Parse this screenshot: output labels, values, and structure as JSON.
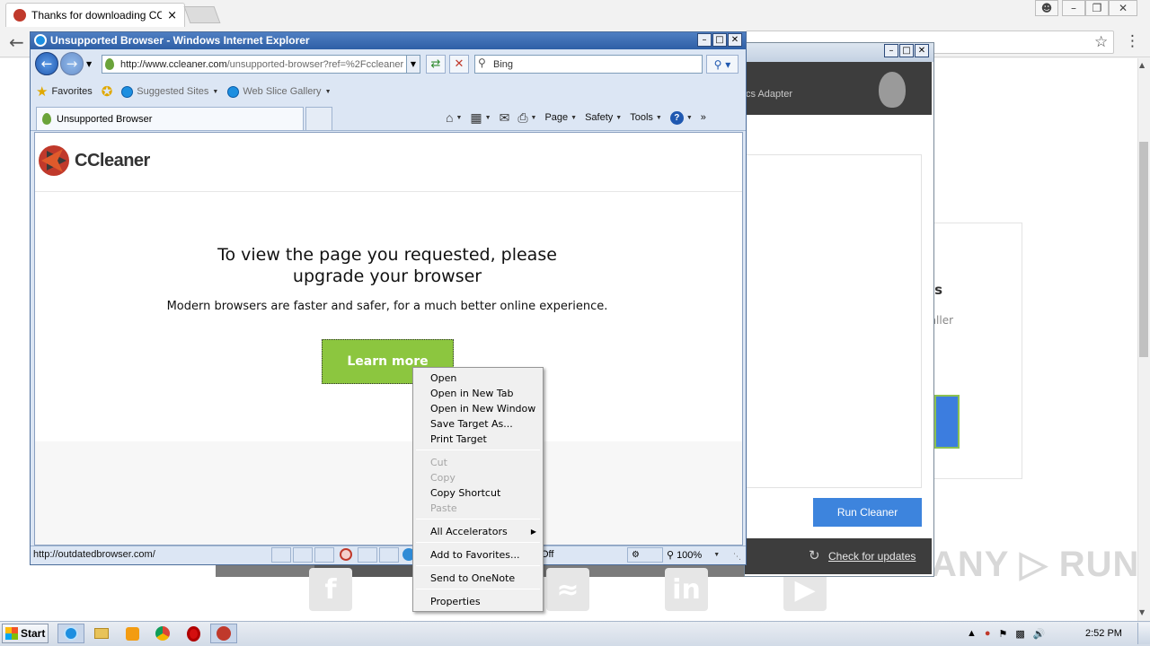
{
  "chrome": {
    "tab_title": "Thanks for downloading CCleaner",
    "tab_close": "×"
  },
  "background_page": {
    "card_text1": "as",
    "card_text2": "taller",
    "watermark": "ANY ▷ RUN"
  },
  "ccleaner_app": {
    "header_text": "cs Adapter",
    "run_button": "Run Cleaner",
    "update_link": "Check for updates"
  },
  "ie": {
    "window_title": "Unsupported Browser - Windows Internet Explorer",
    "address_host": "http://www.ccleaner.com",
    "address_path": "/unsupported-browser?ref=%2Fccleaner",
    "search_placeholder": "Bing",
    "favorites": {
      "favorites_label": "Favorites",
      "suggested_sites": "Suggested Sites",
      "web_slice_gallery": "Web Slice Gallery"
    },
    "tab_title": "Unsupported Browser",
    "commands": {
      "page": "Page",
      "safety": "Safety",
      "tools": "Tools"
    },
    "content": {
      "logo_text": "CCleaner",
      "heading_line1": "To view the page you requested, please",
      "heading_line2": "upgrade your browser",
      "subtext": "Modern browsers are faster and safer, for a much better online experience.",
      "learn_more": "Learn more"
    },
    "status": {
      "url": "http://outdatedbrowser.com/",
      "protected_mode": "Off",
      "zoom": "100%"
    }
  },
  "context_menu": {
    "items": [
      {
        "label": "Open",
        "enabled": true
      },
      {
        "label": "Open in New Tab",
        "enabled": true
      },
      {
        "label": "Open in New Window",
        "enabled": true
      },
      {
        "label": "Save Target As...",
        "enabled": true
      },
      {
        "label": "Print Target",
        "enabled": true
      },
      {
        "label": "Cut",
        "enabled": false
      },
      {
        "label": "Copy",
        "enabled": false
      },
      {
        "label": "Copy Shortcut",
        "enabled": true
      },
      {
        "label": "Paste",
        "enabled": false
      },
      {
        "label": "All Accelerators",
        "enabled": true
      },
      {
        "label": "Add to Favorites...",
        "enabled": true
      },
      {
        "label": "Send to OneNote",
        "enabled": true
      },
      {
        "label": "Properties",
        "enabled": true
      }
    ]
  },
  "taskbar": {
    "start_label": "Start",
    "time": "2:52 PM"
  },
  "colors": {
    "ie_title": "#2e5fa6",
    "learn_more_green": "#8cc63f",
    "run_cleaner_blue": "#3d84dd"
  }
}
